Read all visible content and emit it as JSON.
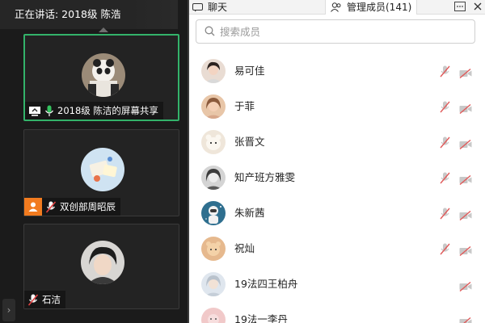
{
  "video": {
    "speaker_text": "正在讲话: 2018级 陈浩",
    "tiles": [
      {
        "label": "2018级 陈洁的屏幕共享",
        "active": true
      },
      {
        "label": "双创部周昭辰",
        "active": false
      },
      {
        "label": "石洁",
        "active": false
      }
    ]
  },
  "side": {
    "tab_chat": "聊天",
    "tab_members": "管理成员(141)",
    "search_placeholder": "搜索成员",
    "members": [
      {
        "name": "易可佳"
      },
      {
        "name": "于菲"
      },
      {
        "name": "张晋文"
      },
      {
        "name": "知产班方雅雯"
      },
      {
        "name": "朱新茜"
      },
      {
        "name": "祝灿"
      },
      {
        "name": "19法四王柏舟"
      },
      {
        "name": "19法一李丹"
      }
    ]
  }
}
